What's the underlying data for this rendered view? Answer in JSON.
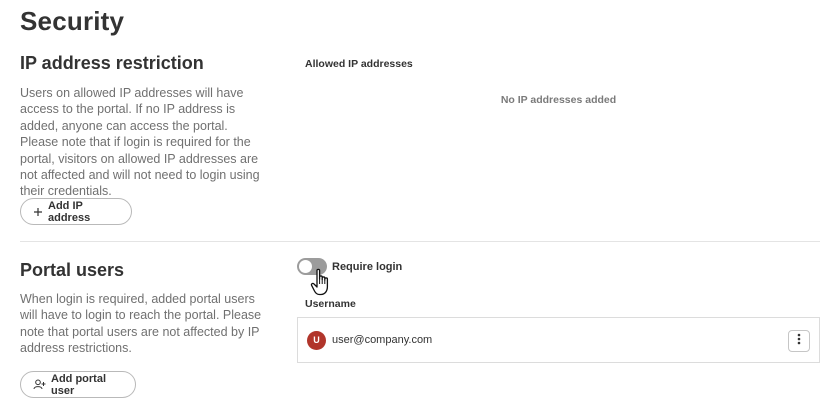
{
  "page": {
    "title": "Security"
  },
  "ip_restriction": {
    "title": "IP address restriction",
    "description": "Users on allowed IP addresses will have access to the portal. If no IP address is added, anyone can access the portal. Please note that if login is required for the portal, visitors on allowed IP addresses are not affected and will not need to login using their credentials.",
    "add_button_label": "Add IP address",
    "list_label": "Allowed IP addresses",
    "empty_text": "No IP addresses added"
  },
  "portal_users": {
    "title": "Portal users",
    "description": "When login is required, added portal users will have to login to reach the portal. Please note that portal users are not affected by IP address restrictions.",
    "add_button_label": "Add portal user",
    "require_login": {
      "label": "Require login",
      "enabled": false
    },
    "username_header": "Username",
    "users": [
      {
        "initial": "U",
        "email": "user@company.com",
        "avatar_color": "#b1352b"
      }
    ]
  },
  "icons": {
    "add_ip": "plus-icon",
    "add_user": "add-user-icon",
    "more": "more-vertical-icon",
    "cursor": "hand-pointer-icon"
  }
}
